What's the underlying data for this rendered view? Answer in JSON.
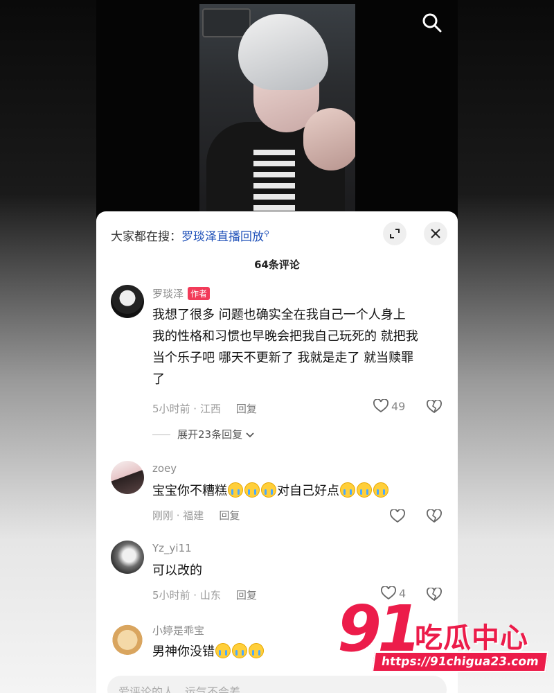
{
  "header": {
    "trending_prefix": "大家都在搜：",
    "trending_link": "罗琰泽直播回放",
    "comment_count": "64条评论"
  },
  "comments": [
    {
      "username": "罗琰泽",
      "badge": "作者",
      "lines": [
        "我想了很多 问题也确实全在我自己一个人身上",
        "我的性格和习惯也早晚会把我自己玩死的 就把我",
        "当个乐子吧 哪天不更新了 我就是走了 就当赎罪",
        "了"
      ],
      "meta": "5小时前 · 江西",
      "reply": "回复",
      "likes": "49",
      "expand": "展开23条回复"
    },
    {
      "username": "zoey",
      "text_before": "宝宝你不糟糕",
      "text_after": "对自己好点",
      "meta": "刚刚 · 福建",
      "reply": "回复"
    },
    {
      "username": "Yz_yi11",
      "text": "可以改的",
      "meta": "5小时前 · 山东",
      "reply": "回复",
      "likes": "4"
    },
    {
      "username": "小婷是乖宝",
      "text": "男神你没错"
    }
  ],
  "input": {
    "placeholder": "爱评论的人，运气不会差"
  },
  "watermark": {
    "number": "91",
    "title": "吃瓜中心",
    "url": "https://91chigua23.com"
  },
  "colors": {
    "accent": "#ec1c4a",
    "link": "#1d4fb8",
    "badge": "#f23b59"
  },
  "icons": [
    "search-icon",
    "expand-icon",
    "close-icon",
    "heart-icon",
    "broken-heart-icon",
    "chevron-down-icon"
  ]
}
